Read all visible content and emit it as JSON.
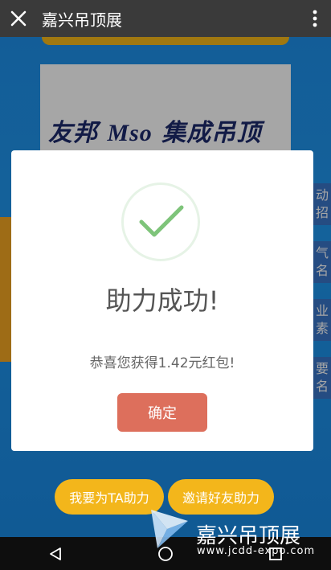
{
  "appbar": {
    "title": "嘉兴吊顶展",
    "close_icon": "close-icon",
    "more_icon": "more-vert-icon"
  },
  "logo": {
    "brand_cn1": "友邦",
    "brand_en": "Mso",
    "brand_cn2": "集成吊顶"
  },
  "side_tabs": [
    "动",
    "招",
    "气",
    "名",
    "业",
    "素",
    "要",
    "名"
  ],
  "modal": {
    "icon": "check-icon",
    "title": "助力成功!",
    "message": "恭喜您获得1.42元红包!",
    "confirm_label": "确定"
  },
  "actions": {
    "help_label": "我要为TA助力",
    "invite_label": "邀请好友助力"
  },
  "watermark": {
    "title": "嘉兴吊顶展",
    "url": "www.jcdd-expo.com"
  },
  "colors": {
    "accent": "#f3b61b",
    "confirm": "#dd6f5c",
    "check": "#7ec47a",
    "appbar": "#3a3a3a"
  }
}
